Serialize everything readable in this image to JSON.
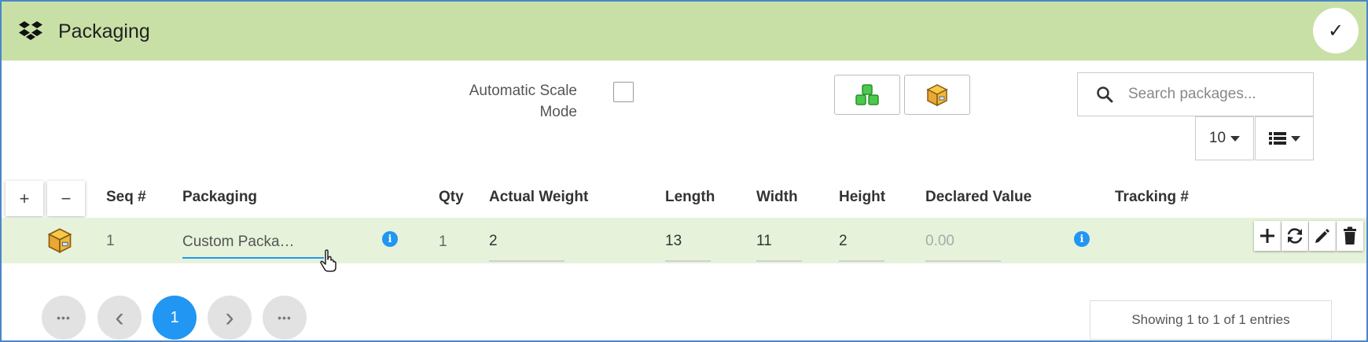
{
  "header": {
    "title": "Packaging",
    "logo_icon": "dropbox-icon",
    "done_icon": "checkmark-icon",
    "bg_color": "#c8e0a6"
  },
  "toolbar": {
    "automatic_scale_mode_label": "Automatic Scale Mode",
    "automatic_scale_mode_checked": false,
    "group_button_icon": "green-boxes-icon",
    "package_button_icon": "package-box-icon",
    "search_placeholder": "Search packages...",
    "page_size": "10",
    "columns_icon": "list-icon"
  },
  "table": {
    "add_row_label": "+",
    "remove_row_label": "−",
    "columns": [
      "Seq #",
      "Packaging",
      "Qty",
      "Actual Weight",
      "Length",
      "Width",
      "Height",
      "Declared Value",
      "Tracking #"
    ],
    "rows": [
      {
        "row_icon": "package-box-icon",
        "seq": "1",
        "packaging": "Custom Packa…",
        "qty": "1",
        "actual_weight": "2",
        "length": "13",
        "width": "11",
        "height": "2",
        "declared_value_placeholder": "0.00",
        "tracking": ""
      }
    ],
    "row_actions": [
      "add-icon",
      "refresh-icon",
      "edit-icon",
      "delete-icon"
    ]
  },
  "pagination": {
    "first_label": "•••",
    "prev_label": "‹",
    "current_page": "1",
    "next_label": "›",
    "last_label": "•••",
    "entries_text": "Showing 1 to 1 of 1 entries"
  },
  "colors": {
    "accent": "#2196f3",
    "row_bg": "#e6f2da",
    "border": "#4a86c8"
  }
}
